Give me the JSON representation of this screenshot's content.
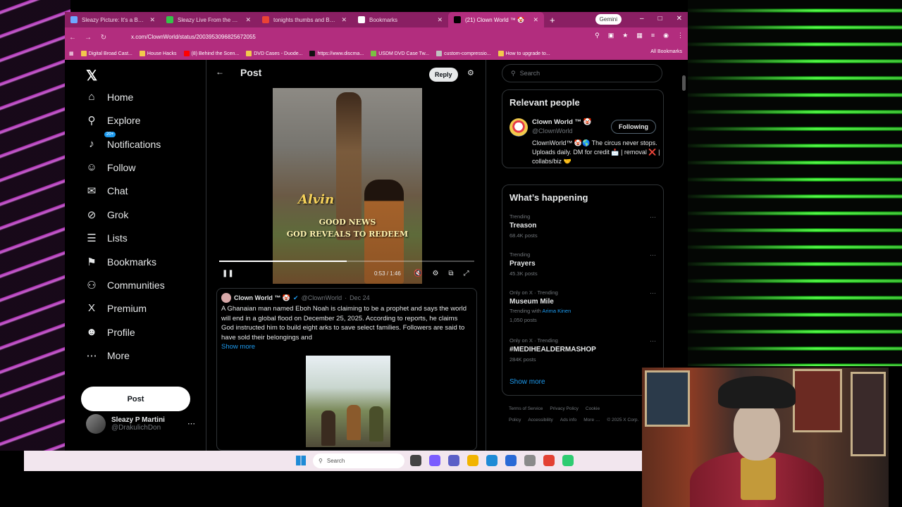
{
  "browser": {
    "tabs": [
      {
        "label": "Sleazy Picture: It's a Busy Day",
        "favicon_color": "#6ea8ff",
        "active": false
      },
      {
        "label": "Sleazy Live From the Bunker",
        "favicon_color": "#36c24a",
        "active": false
      },
      {
        "label": "tonights thumbs and Belt Pr",
        "favicon_color": "#ea4335",
        "active": false
      },
      {
        "label": "Bookmarks",
        "favicon_color": "#ffffff",
        "active": false
      },
      {
        "label": "(21) Clown World ™ 🤡",
        "favicon_color": "#000000",
        "active": true
      }
    ],
    "new_tab": "+",
    "gemini_label": "Gemini",
    "window_controls": [
      "–",
      "□",
      "✕"
    ],
    "url": "x.com/ClownWorld/status/2003953096825672055",
    "bookmarks": [
      {
        "label": "Digital Broad Cast...",
        "color": "#f2c94c"
      },
      {
        "label": "House Hacks",
        "color": "#f2c94c"
      },
      {
        "label": "(8) Behind the Scen...",
        "color": "#ff0000"
      },
      {
        "label": "DVD Cases - Duode...",
        "color": "#f2c94c"
      },
      {
        "label": "https://www.discma...",
        "color": "#111111"
      },
      {
        "label": "USDM DVD Case Tw...",
        "color": "#7bc043"
      },
      {
        "label": "custom-compressio...",
        "color": "#c0c0c0"
      },
      {
        "label": "How to upgrade to...",
        "color": "#f2c94c"
      }
    ],
    "all_bookmarks": "All Bookmarks"
  },
  "nav": {
    "items": [
      {
        "label": "Home",
        "icon": "⌂",
        "icon_name": "home-icon"
      },
      {
        "label": "Explore",
        "icon": "⚲",
        "icon_name": "search-icon"
      },
      {
        "label": "Notifications",
        "icon": "♪",
        "icon_name": "bell-icon"
      },
      {
        "label": "Follow",
        "icon": "☺",
        "icon_name": "follow-icon"
      },
      {
        "label": "Chat",
        "icon": "✉",
        "icon_name": "chat-icon"
      },
      {
        "label": "Grok",
        "icon": "⊘",
        "icon_name": "grok-icon"
      },
      {
        "label": "Lists",
        "icon": "☰",
        "icon_name": "lists-icon"
      },
      {
        "label": "Bookmarks",
        "icon": "⚑",
        "icon_name": "bookmark-icon"
      },
      {
        "label": "Communities",
        "icon": "⚇",
        "icon_name": "communities-icon"
      },
      {
        "label": "Premium",
        "icon": "X",
        "icon_name": "premium-icon"
      },
      {
        "label": "Profile",
        "icon": "☻",
        "icon_name": "profile-icon"
      },
      {
        "label": "More",
        "icon": "⋯",
        "icon_name": "more-icon"
      }
    ],
    "notif_badge": "20+",
    "post_button": "Post",
    "account": {
      "name": "Sleazy P Martini",
      "handle": "@DrakulichDon"
    }
  },
  "main": {
    "title": "Post",
    "reply_button": "Reply",
    "video": {
      "name_overlay": "Alvin",
      "caption1": "GOOD NEWS",
      "caption2": "GOD REVEALS TO REDEEM",
      "time": "0:53 / 1:46",
      "progress": 0.5
    },
    "quote": {
      "author": "Clown World ™ 🤡",
      "handle": "@ClownWorld",
      "date": "Dec 24",
      "text": "A Ghanaian man named Eboh Noah is claiming to be a prophet and says the world will end in a global flood on December 25, 2025. According to reports, he claims God instructed him to build eight arks to save select families. Followers are said to have sold their belongings and",
      "show_more": "Show more"
    }
  },
  "right": {
    "search_placeholder": "Search",
    "relevant": {
      "title": "Relevant people",
      "name": "Clown World ™ 🤡",
      "handle": "@ClownWorld",
      "button": "Following",
      "bio": "ClownWorld™ 🤡🌎 The circus never stops. Uploads daily. DM for credit 📩 | removal ❌ | collabs/biz 🤝"
    },
    "happening": {
      "title": "What’s happening",
      "trends": [
        {
          "context": "Trending",
          "name": "Treason",
          "count": "68.4K posts",
          "with": "",
          "with_link": ""
        },
        {
          "context": "Trending",
          "name": "Prayers",
          "count": "45.3K posts",
          "with": "",
          "with_link": ""
        },
        {
          "context": "Only on X · Trending",
          "name": "Museum Mile",
          "count": "1,050 posts",
          "with": "Trending with",
          "with_link": "Arima Kinen"
        },
        {
          "context": "Only on X · Trending",
          "name": "#MEDIHEALDERMASHOP",
          "count": "284K posts",
          "with": "",
          "with_link": ""
        }
      ],
      "show_more": "Show more"
    },
    "footer": [
      "Terms of Service",
      "Privacy Policy",
      "Cookie Policy",
      "Accessibility",
      "Ads info",
      "More …",
      "© 2025 X Corp."
    ]
  },
  "taskbar": {
    "search_placeholder": "Search",
    "apps": [
      {
        "name": "taskview",
        "color": "#444444"
      },
      {
        "name": "copilot",
        "color": "#7b5cff"
      },
      {
        "name": "teams",
        "color": "#5b5fc7"
      },
      {
        "name": "explorer",
        "color": "#f2b400"
      },
      {
        "name": "edge",
        "color": "#1f8bd6"
      },
      {
        "name": "store",
        "color": "#2a6ad6"
      },
      {
        "name": "settings",
        "color": "#8a8a8a"
      },
      {
        "name": "chrome",
        "color": "#e34133"
      },
      {
        "name": "obs",
        "color": "#2ecc71"
      }
    ]
  }
}
